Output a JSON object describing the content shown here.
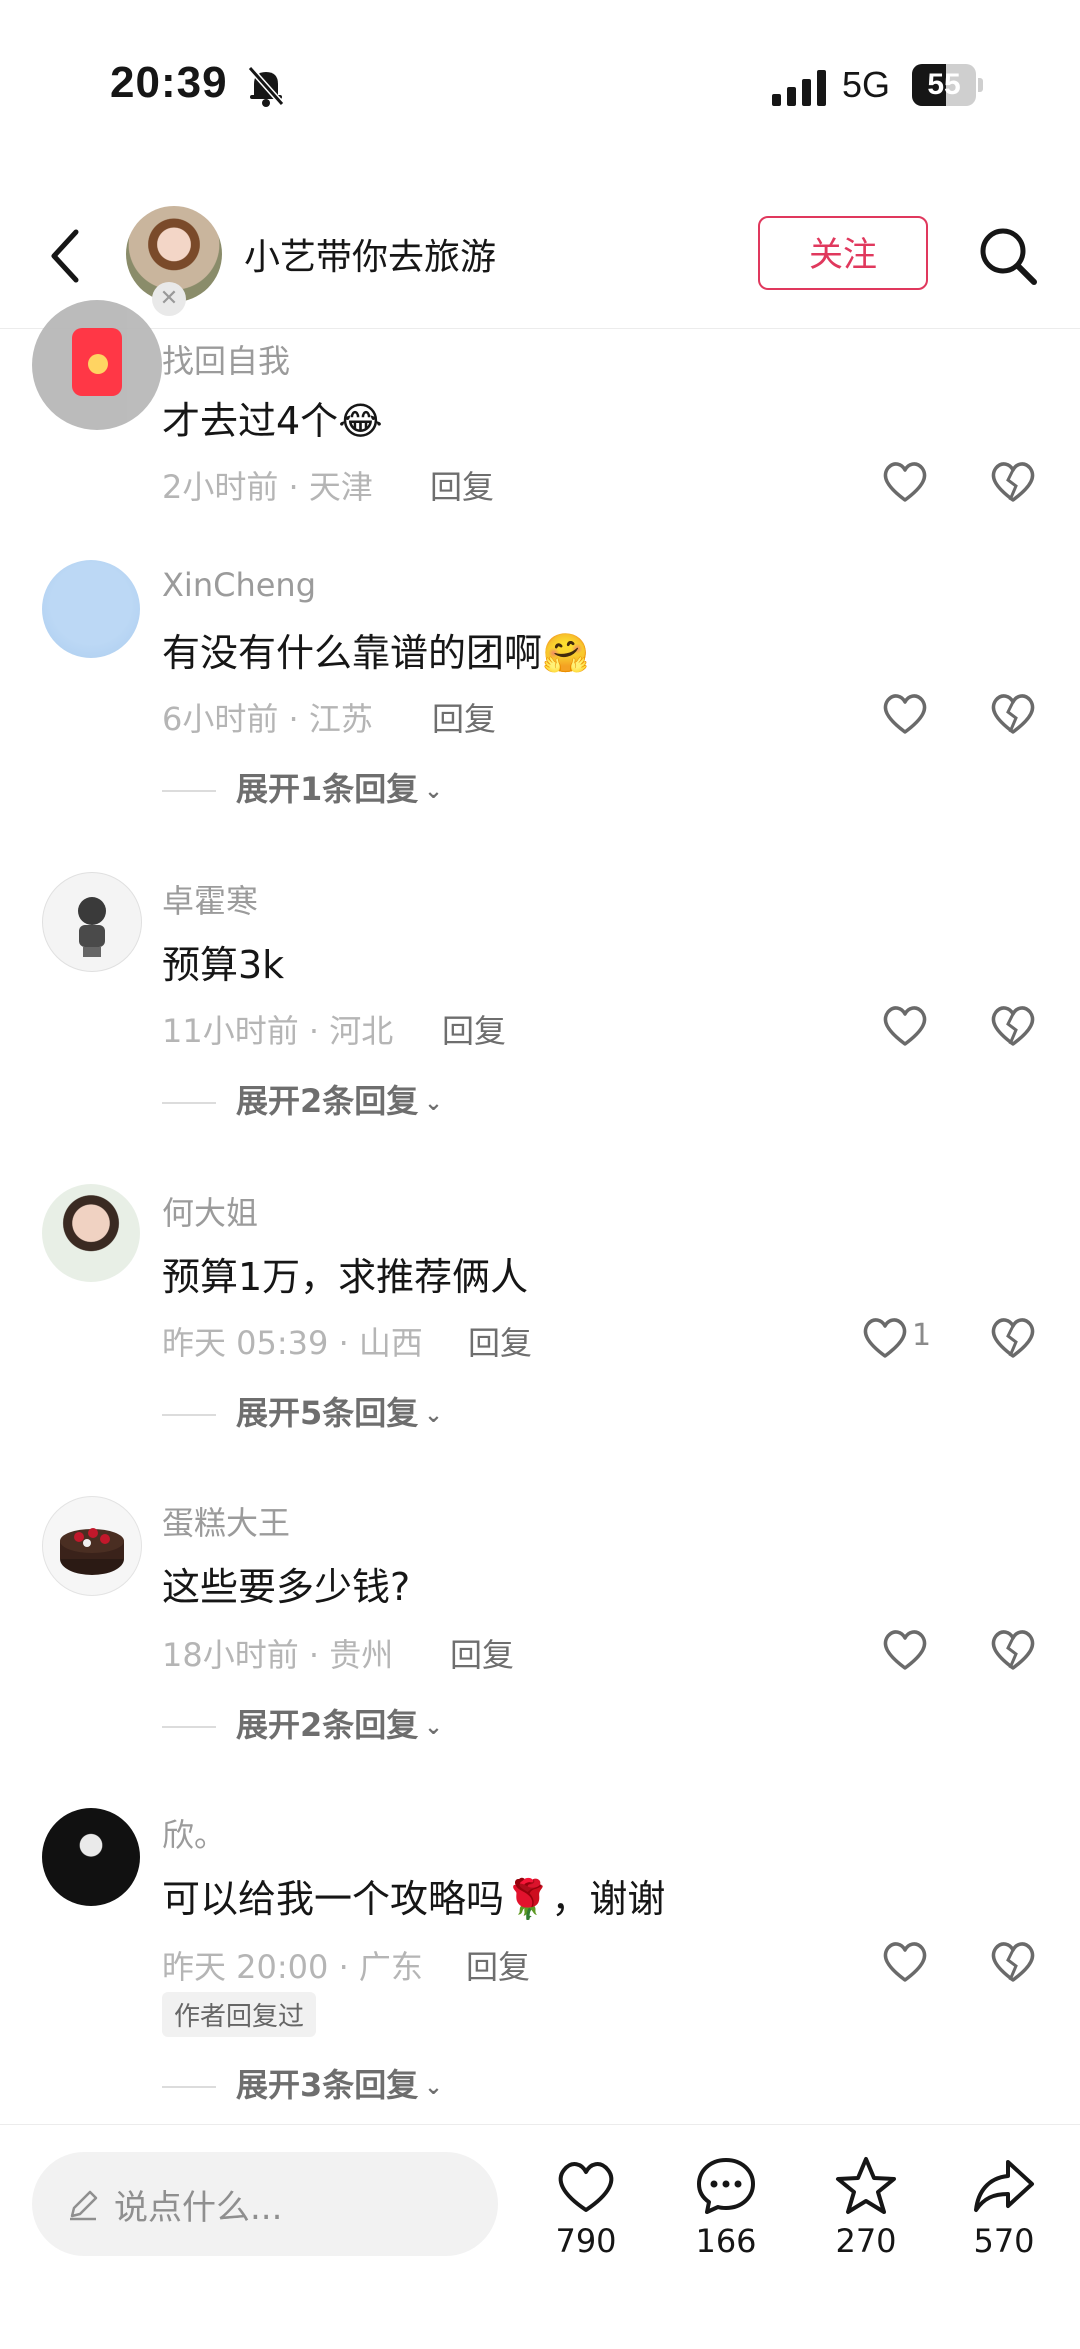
{
  "status_bar": {
    "time": "20:39",
    "network": "5G",
    "battery": "55"
  },
  "header": {
    "author_name": "小艺带你去旅游",
    "follow_label": "关注"
  },
  "comments": [
    {
      "user": "找回自我",
      "text": "才去过4个",
      "emoji": "😂",
      "meta": "2小时前 · 天津",
      "reply_label": "回复",
      "likes": "",
      "expand": ""
    },
    {
      "user": "XinCheng",
      "text": "有没有什么靠谱的团啊",
      "emoji": "🤗",
      "meta": "6小时前 · 江苏",
      "reply_label": "回复",
      "likes": "",
      "expand": "展开1条回复"
    },
    {
      "user": "卓霍寒",
      "text": "预算3k",
      "emoji": "",
      "meta": "11小时前 · 河北",
      "reply_label": "回复",
      "likes": "",
      "expand": "展开2条回复"
    },
    {
      "user": "何大姐",
      "text": "预算1万，求推荐俩人",
      "emoji": "",
      "meta": "昨天 05:39 · 山西",
      "reply_label": "回复",
      "likes": "1",
      "expand": "展开5条回复"
    },
    {
      "user": "蛋糕大王",
      "text": "这些要多少钱?",
      "emoji": "",
      "meta": "18小时前 · 贵州",
      "reply_label": "回复",
      "likes": "",
      "expand": "展开2条回复"
    },
    {
      "user": "欣。",
      "text": "可以给我一个攻略吗",
      "emoji": "🌹",
      "text_suffix": "，谢谢",
      "meta": "昨天 20:00 · 广东",
      "reply_label": "回复",
      "likes": "",
      "tag": "作者回复过",
      "expand": "展开3条回复"
    }
  ],
  "bottom_bar": {
    "input_placeholder": "说点什么...",
    "likes": "790",
    "comments": "166",
    "favorites": "270",
    "shares": "570"
  },
  "colors": {
    "accent": "#e0385d"
  }
}
